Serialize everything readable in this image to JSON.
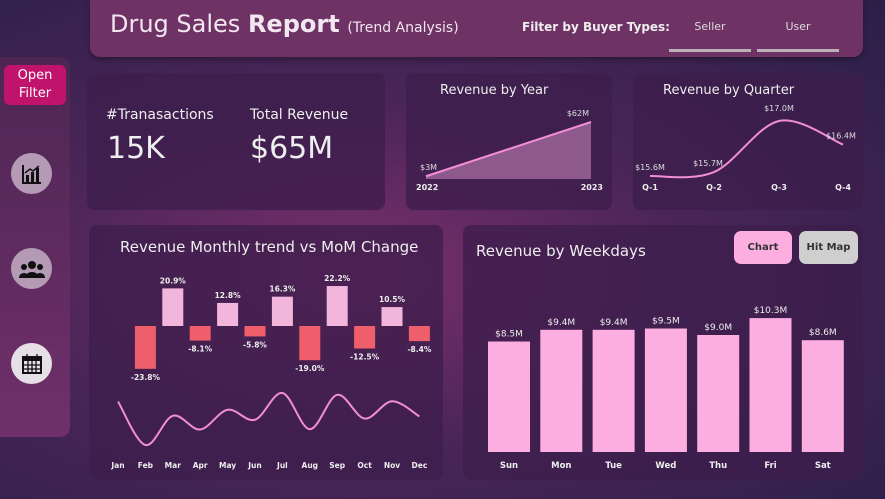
{
  "header": {
    "title_light": "Drug Sales ",
    "title_bold": "Report",
    "title_sub": "(Trend Analysis)",
    "filter_label": "Filter by Buyer Types:",
    "filters": [
      "Seller",
      "User"
    ]
  },
  "sidebar": {
    "open_filter_line1": "Open",
    "open_filter_line2": "Filter",
    "icons": [
      "chart-icon",
      "users-icon",
      "calendar-icon"
    ]
  },
  "kpis": [
    {
      "label": "#Tranasactions",
      "value": "15K"
    },
    {
      "label": "Total Revenue",
      "value": "$65M"
    }
  ],
  "colors": {
    "accent": "#c0146c",
    "line": "#f28fd4",
    "positive": "#f2b6dd",
    "negative": "#ee5f6b",
    "weekday_bar": "#fcaee0"
  },
  "chart_data": [
    {
      "type": "area",
      "title": "Revenue by Year",
      "categories": [
        "2022",
        "2023"
      ],
      "values": [
        3,
        62
      ],
      "labels": [
        "$3M",
        "$62M"
      ],
      "unit": "$M"
    },
    {
      "type": "line",
      "title": "Revenue by Quarter",
      "categories": [
        "Q-1",
        "Q-2",
        "Q-3",
        "Q-4"
      ],
      "values": [
        15.6,
        15.7,
        17.0,
        16.4
      ],
      "labels": [
        "$15.6M",
        "$15.7M",
        "$17.0M",
        "$16.4M"
      ],
      "unit": "$M"
    },
    {
      "type": "bar",
      "title": "Revenue Monthly trend vs MoM Change",
      "categories": [
        "Jan",
        "Feb",
        "Mar",
        "Apr",
        "May",
        "Jun",
        "Jul",
        "Aug",
        "Sep",
        "Oct",
        "Nov",
        "Dec"
      ],
      "mom_change": [
        null,
        -23.8,
        20.9,
        -8.1,
        12.8,
        -5.8,
        16.3,
        -19.0,
        22.2,
        -12.5,
        10.5,
        -8.4
      ],
      "mom_labels": [
        "",
        "-23.8%",
        "20.9%",
        "-8.1%",
        "12.8%",
        "-5.8%",
        "16.3%",
        "-19.0%",
        "22.2%",
        "-12.5%",
        "10.5%",
        "-8.4%"
      ],
      "revenue_trend": [
        6.0,
        4.57,
        5.53,
        5.08,
        5.73,
        5.4,
        6.28,
        5.09,
        6.22,
        5.44,
        6.01,
        5.51
      ]
    },
    {
      "type": "bar",
      "title": "Revenue by Weekdays",
      "categories": [
        "Sun",
        "Mon",
        "Tue",
        "Wed",
        "Thu",
        "Fri",
        "Sat"
      ],
      "values": [
        8.5,
        9.4,
        9.4,
        9.5,
        9.0,
        10.3,
        8.6
      ],
      "labels": [
        "$8.5M",
        "$9.4M",
        "$9.4M",
        "$9.5M",
        "$9.0M",
        "$10.3M",
        "$8.6M"
      ],
      "unit": "$M"
    }
  ],
  "toggle": {
    "chart": "Chart",
    "hitmap": "Hit Map"
  }
}
